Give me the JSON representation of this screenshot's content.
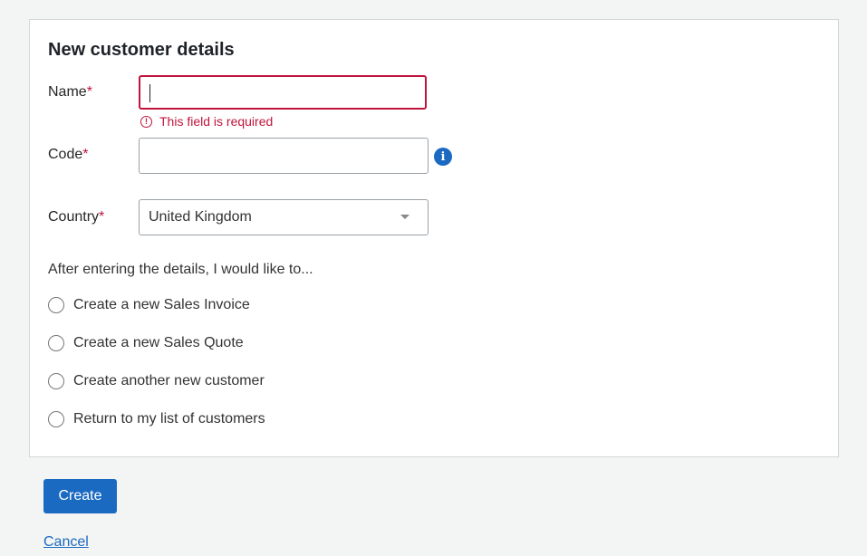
{
  "form": {
    "title": "New customer details",
    "required_marker": "*",
    "name": {
      "label": "Name",
      "value": "",
      "error": "This field is required",
      "error_icon": "!"
    },
    "code": {
      "label": "Code",
      "value": "",
      "info_icon": "i"
    },
    "country": {
      "label": "Country",
      "selected": "United Kingdom"
    },
    "after_prompt": "After entering the details, I would like to...",
    "options": [
      {
        "label": "Create a new Sales Invoice",
        "checked": false
      },
      {
        "label": "Create a new Sales Quote",
        "checked": false
      },
      {
        "label": "Create another new customer",
        "checked": false
      },
      {
        "label": "Return to my list of customers",
        "checked": false
      }
    ]
  },
  "actions": {
    "create_label": "Create",
    "cancel_label": "Cancel"
  },
  "colors": {
    "accent": "#1b6ac2",
    "error": "#c0143c",
    "background": "#f3f4f4"
  }
}
